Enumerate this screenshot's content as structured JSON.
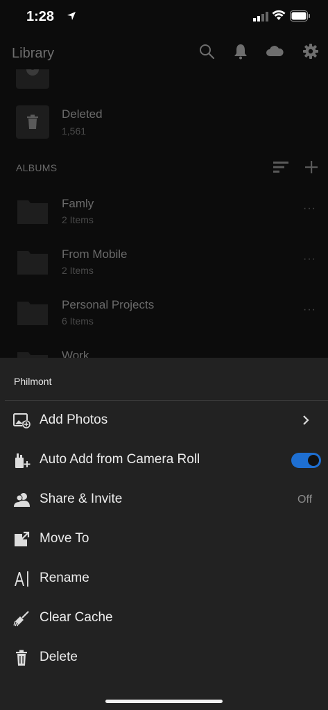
{
  "status_bar": {
    "time": "1:28"
  },
  "nav": {
    "title": "Library"
  },
  "library": {
    "deleted": {
      "name": "Deleted",
      "count": "1,561"
    },
    "albums_label": "ALBUMS",
    "albums": [
      {
        "name": "Famly",
        "sub": "2 Items"
      },
      {
        "name": "From Mobile",
        "sub": "2 Items"
      },
      {
        "name": "Personal Projects",
        "sub": "6 Items"
      },
      {
        "name": "Work",
        "sub": ""
      }
    ],
    "more_label": "···"
  },
  "sheet": {
    "title": "Philmont",
    "items": [
      {
        "label": "Add Photos",
        "icon": "add-photos-icon"
      },
      {
        "label": "Auto Add from Camera Roll",
        "icon": "auto-add-icon",
        "toggle_on": true
      },
      {
        "label": "Share & Invite",
        "icon": "share-invite-icon",
        "status": "Off"
      },
      {
        "label": "Move To",
        "icon": "move-to-icon"
      },
      {
        "label": "Rename",
        "icon": "rename-icon"
      },
      {
        "label": "Clear Cache",
        "icon": "clear-cache-icon"
      },
      {
        "label": "Delete",
        "icon": "delete-icon"
      }
    ]
  },
  "colors": {
    "accent": "#1e6fd2",
    "sheet_bg": "#222222",
    "page_bg": "#0c0c0c"
  }
}
